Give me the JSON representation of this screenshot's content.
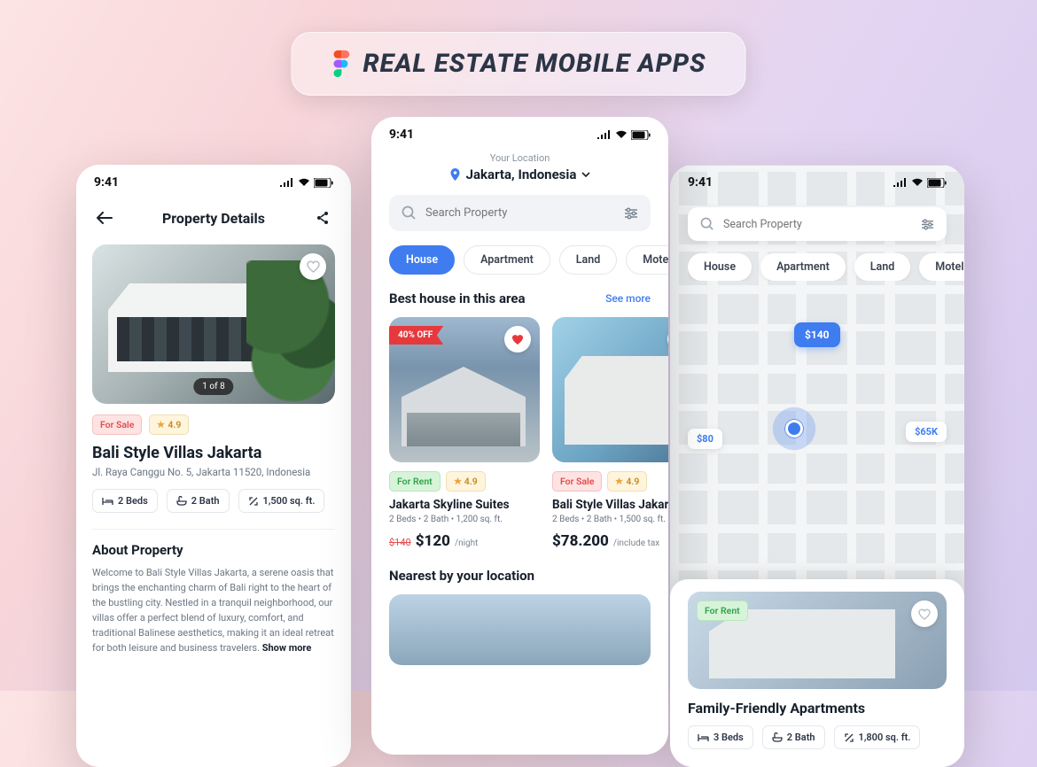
{
  "banner": {
    "title": "REAL ESTATE MOBILE APPS"
  },
  "status": {
    "time": "9:41"
  },
  "phone1": {
    "header_title": "Property Details",
    "image_counter": "1 of 8",
    "sale_tag": "For Sale",
    "rating": "4.9",
    "title": "Bali Style Villas Jakarta",
    "address": "Jl. Raya Canggu No. 5, Jakarta 11520, Indonesia",
    "specs": {
      "beds": "2 Beds",
      "bath": "2 Bath",
      "area": "1,500 sq. ft."
    },
    "about_heading": "About Property",
    "about_body": "Welcome to Bali Style Villas Jakarta, a serene oasis that brings the enchanting charm of Bali right to the heart of the bustling city. Nestled in a tranquil neighborhood, our villas offer a perfect blend of luxury, comfort, and traditional Balinese aesthetics, making it an ideal retreat for both leisure and business travelers. ",
    "show_more": "Show more"
  },
  "phone2": {
    "location_label": "Your Location",
    "location_value": "Jakarta, Indonesia",
    "search_placeholder": "Search Property",
    "chips": [
      "House",
      "Apartment",
      "Land",
      "Motels"
    ],
    "section1_title": "Best house in this area",
    "see_more": "See more",
    "card1": {
      "ribbon": "40% OFF",
      "tag": "For Rent",
      "rating": "4.9",
      "title": "Jakarta Skyline Suites",
      "sub": "2 Beds • 2 Bath • 1,200 sq. ft.",
      "old_price": "$140",
      "price": "$120",
      "per": "/night"
    },
    "card2": {
      "tag": "For Sale",
      "rating": "4.9",
      "title": "Bali Style Villas Jakarta",
      "sub": "2 Beds • 2 Bath • 1,500 sq. ft.",
      "price": "$78.200",
      "per": "/include tax"
    },
    "section2_title": "Nearest by your location"
  },
  "phone3": {
    "search_placeholder": "Search Property",
    "chips": [
      "House",
      "Apartment",
      "Land",
      "Motels"
    ],
    "pins": {
      "p1": "$140",
      "p2": "$80",
      "p3": "$65K"
    },
    "card": {
      "tag": "For Rent",
      "title": "Family-Friendly Apartments",
      "specs": {
        "beds": "3 Beds",
        "bath": "2 Bath",
        "area": "1,800 sq. ft."
      }
    }
  }
}
